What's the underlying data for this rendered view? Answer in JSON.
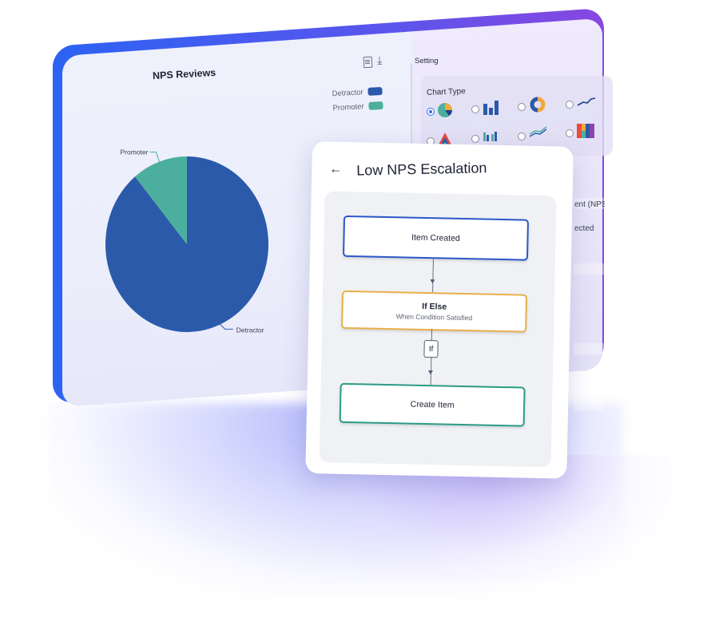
{
  "chart_panel": {
    "title": "NPS Reviews",
    "toolbar": {
      "doc_icon": "document-icon",
      "download_icon": "download-icon"
    },
    "legend": [
      {
        "label": "Detractor",
        "color": "#2b5aaa"
      },
      {
        "label": "Promoter",
        "color": "#4caf9e"
      }
    ]
  },
  "chart_data": {
    "type": "pie",
    "title": "NPS Reviews",
    "labels": [
      "Detractor",
      "Promoter"
    ],
    "values": [
      89,
      11
    ],
    "colors": [
      "#2b5aaa",
      "#4caf9e"
    ],
    "legend": "top-right"
  },
  "settings": {
    "title": "Setting",
    "chart_type_label": "Chart Type",
    "chart_types": [
      {
        "name": "pie",
        "selected": true
      },
      {
        "name": "bar",
        "selected": false
      },
      {
        "name": "donut",
        "selected": false
      },
      {
        "name": "line",
        "selected": false
      },
      {
        "name": "area-stacked",
        "selected": false
      },
      {
        "name": "grouped-bar",
        "selected": false
      },
      {
        "name": "multi-line",
        "selected": false
      },
      {
        "name": "heatmap",
        "selected": false
      }
    ],
    "partial_texts": [
      "ent (NPS",
      "ected"
    ]
  },
  "workflow": {
    "back_icon": "←",
    "title": "Low NPS Escalation",
    "nodes": [
      {
        "title": "Item Created",
        "subtitle": "",
        "color": "#2a58c8"
      },
      {
        "title": "If Else",
        "subtitle": "When Condition Satisfied",
        "color": "#e8b04b"
      },
      {
        "title": "Create Item",
        "subtitle": "",
        "color": "#2a9c85"
      }
    ],
    "branch_label": "If"
  }
}
